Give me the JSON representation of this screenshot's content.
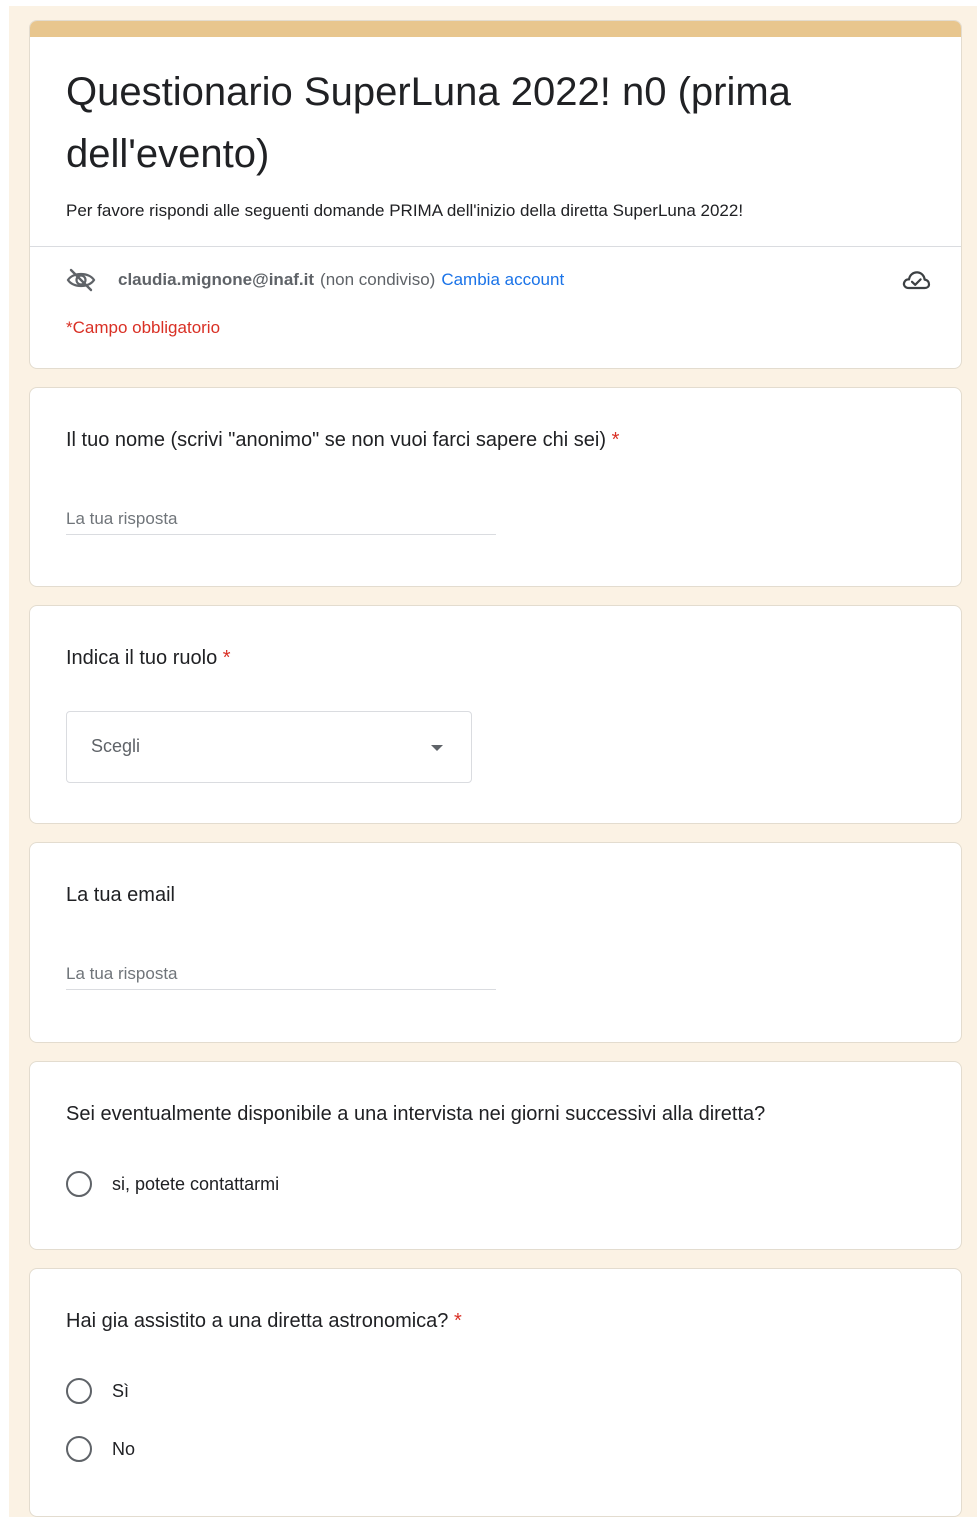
{
  "header": {
    "title": "Questionario SuperLuna 2022! n0 (prima dell'evento)",
    "description": "Per favore rispondi alle seguenti domande PRIMA dell'inizio della diretta SuperLuna 2022!",
    "account_email": "claudia.mignone@inaf.it",
    "not_shared_text": "(non condiviso)",
    "switch_account": "Cambia account",
    "required_note": "*Campo obbligatorio"
  },
  "questions": {
    "name": {
      "label": "Il tuo nome (scrivi \"anonimo\" se non vuoi farci sapere chi sei)",
      "required_mark": "*",
      "placeholder": "La tua risposta"
    },
    "role": {
      "label": "Indica il tuo ruolo",
      "required_mark": "*",
      "selected_value": "Scegli"
    },
    "email": {
      "label": "La tua email",
      "placeholder": "La tua risposta"
    },
    "interview": {
      "label": "Sei eventualmente disponibile a una intervista nei giorni successivi alla diretta?",
      "options": [
        "si, potete contattarmi"
      ]
    },
    "attended": {
      "label": "Hai gia assistito a una diretta astronomica?",
      "required_mark": "*",
      "options": [
        "Sì",
        "No"
      ]
    }
  },
  "colors": {
    "accent": "#e8c68e",
    "page_background": "#fbf2e4",
    "required": "#d93025",
    "link": "#1a73e8"
  },
  "icons": {
    "visibility": "eye-off-icon",
    "cloud": "cloud-done-icon",
    "dropdown": "caret-down-icon"
  }
}
